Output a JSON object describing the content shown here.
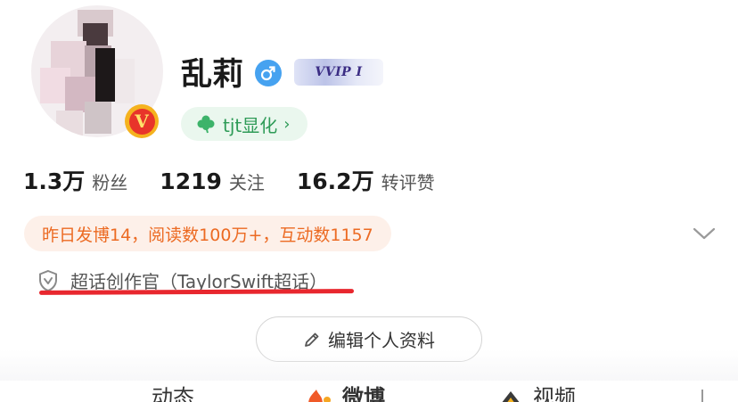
{
  "profile": {
    "name": "乱莉",
    "vip_badge": "VVIP I",
    "gender_icon": "male-icon",
    "verified_badge": "V",
    "tag_label": "tjt显化",
    "tag_chevron": "›"
  },
  "stats": [
    {
      "value": "1.3万",
      "label": "粉丝"
    },
    {
      "value": "1219",
      "label": "关注"
    },
    {
      "value": "16.2万",
      "label": "转评赞"
    }
  ],
  "highlight": "昨日发博14，阅读数100万+，互动数1157",
  "super_topic": "超话创作官（TaylorSwift超话）",
  "edit_profile_label": "编辑个人资料",
  "tabs": [
    {
      "label": "动态"
    },
    {
      "label": "微博"
    },
    {
      "label": "视频"
    }
  ],
  "colors": {
    "accent_green": "#2e9b57",
    "highlight_orange": "#ec6a22",
    "gender_blue": "#46a2f0",
    "annotation_red": "#e8272e"
  }
}
